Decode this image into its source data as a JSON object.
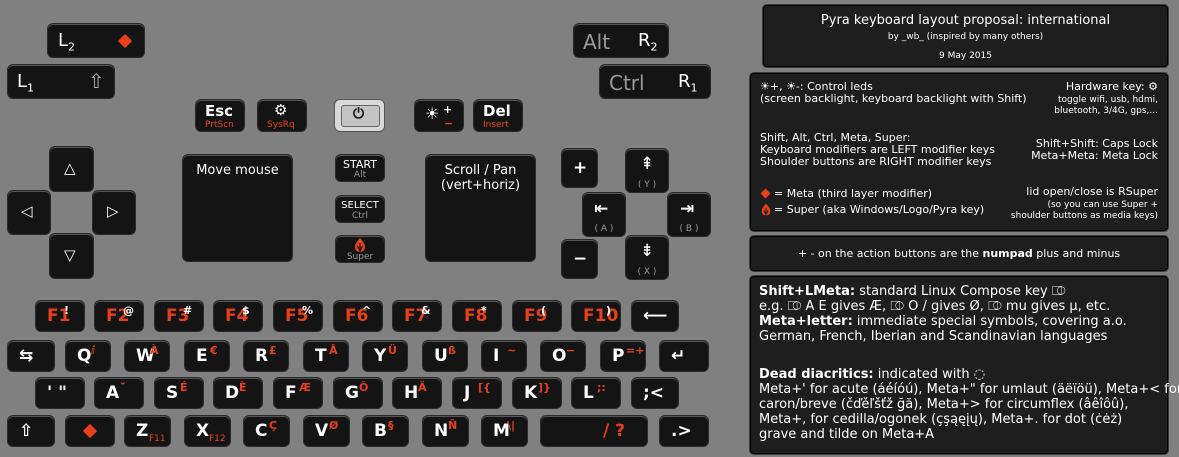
{
  "shoulders": {
    "l2": {
      "main": "L",
      "subscript": "2"
    },
    "l1": {
      "main": "L",
      "subscript": "1",
      "shift_glyph": "⇧"
    },
    "r2": {
      "alt": "Alt",
      "main": "R",
      "subscript": "2"
    },
    "r1": {
      "ctrl": "Ctrl",
      "main": "R",
      "subscript": "1"
    }
  },
  "top_keys": {
    "esc": {
      "label": "Esc",
      "sub": "PrtScn"
    },
    "gear": {
      "label": "⚙",
      "sub": "SysRq"
    },
    "power": {
      "label": "⏻"
    },
    "brightness": {
      "label": "☀",
      "plus": "+",
      "minus": "−"
    },
    "del": {
      "label": "Del",
      "sub": "Insert"
    }
  },
  "dpad": {
    "up": "△",
    "left": "◁",
    "right": "▷",
    "down": "▽"
  },
  "touch_left": {
    "label": "Move mouse"
  },
  "touch_right": {
    "label_line1": "Scroll / Pan",
    "label_line2": "(vert+horiz)"
  },
  "center_buttons": {
    "start": {
      "label": "START",
      "sub": "Alt"
    },
    "select": {
      "label": "SELECT",
      "sub": "Ctrl"
    },
    "super": {
      "sub": "Super"
    }
  },
  "action_buttons": {
    "plus": "+",
    "minus": "−",
    "y": {
      "glyph": "⇞",
      "label": "( Y )"
    },
    "a": {
      "glyph": "⇤",
      "label": "( A )"
    },
    "b": {
      "glyph": "⇥",
      "label": "( B )"
    },
    "x": {
      "glyph": "⇟",
      "label": "( X )"
    }
  },
  "row1": [
    {
      "main": "F1",
      "sup": "!"
    },
    {
      "main": "F2",
      "sup": "@"
    },
    {
      "main": "F3",
      "sup": "#"
    },
    {
      "main": "F4",
      "sup": "$"
    },
    {
      "main": "F5",
      "sup": "%"
    },
    {
      "main": "F6",
      "sup": "^"
    },
    {
      "main": "F7",
      "sup": "&"
    },
    {
      "main": "F8",
      "sup": "*"
    },
    {
      "main": "F9",
      "sup": "("
    },
    {
      "main": "F10",
      "sup": ")"
    },
    {
      "main": "⟵",
      "sup": ""
    }
  ],
  "row2": [
    {
      "main": "⇆",
      "sup": ""
    },
    {
      "main": "Q",
      "sup": "ⅈ"
    },
    {
      "main": "W",
      "sup": "À"
    },
    {
      "main": "E",
      "sup": "€"
    },
    {
      "main": "R",
      "sup": "£"
    },
    {
      "main": "T",
      "sup": "Å"
    },
    {
      "main": "Y",
      "sup": "Ü"
    },
    {
      "main": "U",
      "sup": "ß"
    },
    {
      "main": "I",
      "sup": "~"
    },
    {
      "main": "O",
      "sup": "−"
    },
    {
      "main": "P",
      "sup": "=+"
    },
    {
      "main": "↵",
      "sup": ""
    }
  ],
  "row3": [
    {
      "main": "' \"",
      "sup": ""
    },
    {
      "main": "A",
      "sup": "ˇ̆"
    },
    {
      "main": "S",
      "sup": "É"
    },
    {
      "main": "D",
      "sup": "È"
    },
    {
      "main": "F",
      "sup": "Æ"
    },
    {
      "main": "G",
      "sup": "Ô"
    },
    {
      "main": "H",
      "sup": "Ä"
    },
    {
      "main": "J",
      "sup": "[{"
    },
    {
      "main": "K",
      "sup": "]}"
    },
    {
      "main": "L",
      "sup": ";:"
    },
    {
      "main": ";<",
      "sup": ""
    }
  ],
  "row4": [
    {
      "main": "⇧",
      "sup": ""
    },
    {
      "main": "",
      "sup": ""
    },
    {
      "main": "Z",
      "sup": "F11"
    },
    {
      "main": "X",
      "sup": "F12"
    },
    {
      "main": "C",
      "sup": "Ç"
    },
    {
      "main": "V",
      "sup": "Ø"
    },
    {
      "main": "B",
      "sup": "§"
    },
    {
      "main": "N",
      "sup": "Ñ"
    },
    {
      "main": "M",
      "sup": "\\|"
    },
    {
      "main": "/ ?",
      "sup": ""
    },
    {
      "main": ".>",
      "sup": ""
    }
  ],
  "panel_title": {
    "title": "Pyra keyboard layout proposal: international",
    "byline": "by _wb_ (inspired by many others)",
    "date": "9 May 2015"
  },
  "panel_info": {
    "leds": "☀+, ☀-: Control leds\n(screen backlight, keyboard backlight with Shift)",
    "hwkey_title": "Hardware key: ⚙",
    "hwkey_desc": "toggle wifi, usb, hdmi,\nbluetooth, 3/4G, gps,...",
    "modifiers": "Shift, Alt, Ctrl, Meta, Super:\nKeyboard modifiers are LEFT modifier keys\nShoulder buttons are RIGHT modifier keys",
    "locks": "Shift+Shift: Caps Lock\nMeta+Meta: Meta Lock",
    "meta": "= Meta (third layer modifier)",
    "super": "= Super (aka Windows/Logo/Pyra key)",
    "lid_title": "lid open/close is RSuper",
    "lid_desc": "(so you can use Super +\nshoulder buttons as media keys)"
  },
  "panel_numpad": {
    "text_before": "+ - on the action buttons are the ",
    "text_bold": "numpad",
    "text_after": " plus and minus"
  },
  "panel_compose": {
    "l1_bold": "Shift+LMeta:",
    "l1_rest": " standard Linux Compose key ⎄",
    "l2": "e.g. ⎄ A E gives Æ, ⎄ O / gives Ø, ⎄ mu gives μ, etc.",
    "l3_bold": "Meta+letter:",
    "l3_rest": " immediate special symbols, covering a.o.",
    "l4": "German, French, Iberian and Scandinavian languages",
    "l5_bold": "Dead diacritics:",
    "l5_rest": " indicated with ◌",
    "l6": "Meta+' for acute (áéíóú), Meta+\" for umlaut (äëïöü), Meta+< for",
    "l7": "caron/breve (čďěľšťž ğă), Meta+> for circumflex (âêîôû),",
    "l8": "Meta+, for cedilla/ogonek (çşąęįų), Meta+. for dot (ċėż)",
    "l9": "grave and tilde on Meta+A"
  },
  "colors": {
    "accent": "#e8401a",
    "key": "#141414",
    "background": "#808080",
    "panel": "#1e1e1e"
  }
}
